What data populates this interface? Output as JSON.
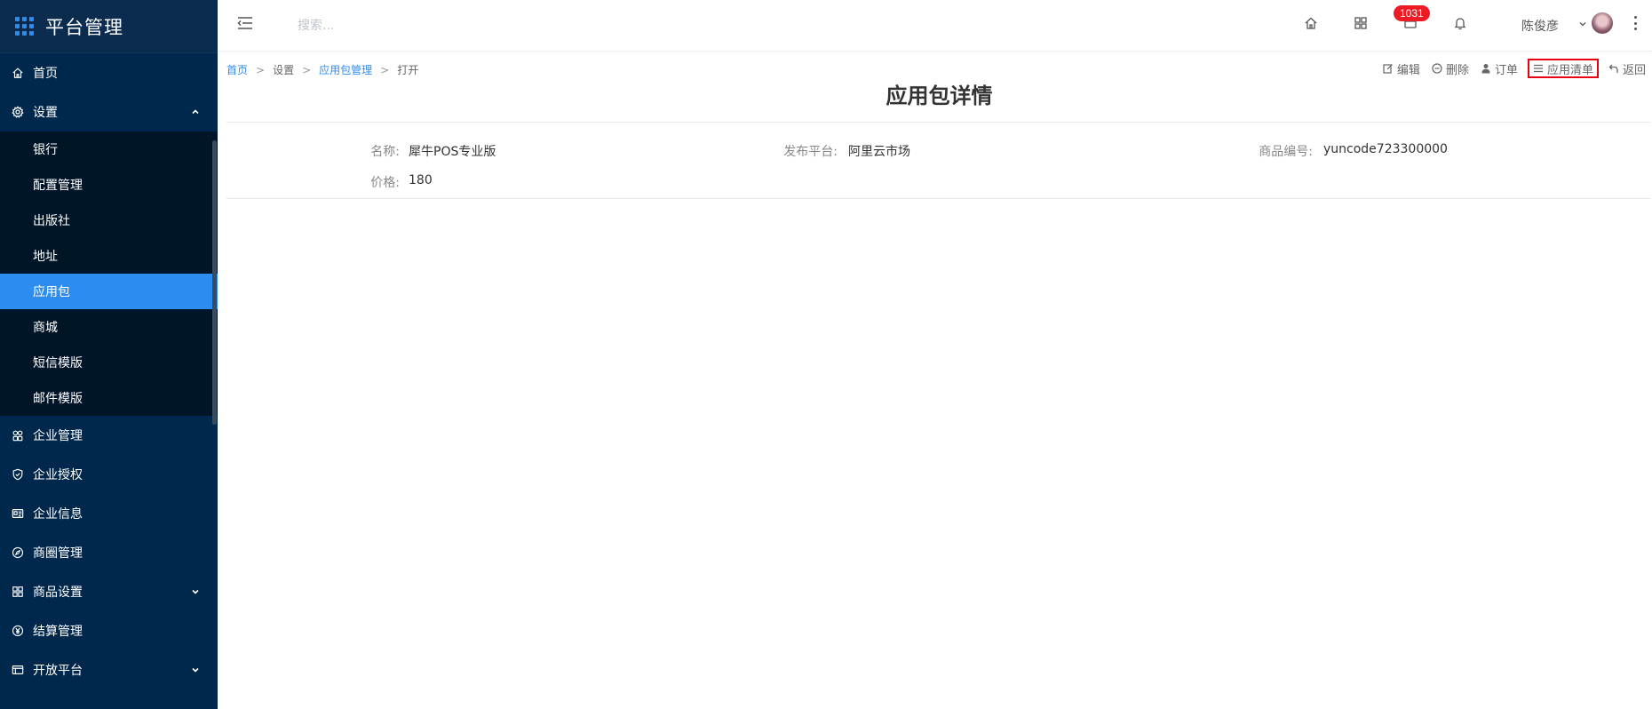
{
  "app": {
    "title": "平台管理"
  },
  "sidebar": {
    "items": [
      {
        "label": "首页",
        "icon": "home-icon"
      },
      {
        "label": "设置",
        "icon": "gear-icon",
        "expanded": true,
        "children": [
          {
            "label": "银行"
          },
          {
            "label": "配置管理"
          },
          {
            "label": "出版社"
          },
          {
            "label": "地址"
          },
          {
            "label": "应用包",
            "active": true
          },
          {
            "label": "商城"
          },
          {
            "label": "短信模版"
          },
          {
            "label": "邮件模版"
          }
        ]
      },
      {
        "label": "企业管理",
        "icon": "enterprise-icon"
      },
      {
        "label": "企业授权",
        "icon": "shield-icon"
      },
      {
        "label": "企业信息",
        "icon": "id-card-icon"
      },
      {
        "label": "商圈管理",
        "icon": "compass-icon"
      },
      {
        "label": "商品设置",
        "icon": "grid-icon",
        "collapsed": true
      },
      {
        "label": "结算管理",
        "icon": "yen-icon"
      },
      {
        "label": "开放平台",
        "icon": "panel-icon",
        "collapsed": true
      }
    ]
  },
  "header": {
    "search_placeholder": "搜索...",
    "badge_count": "1031",
    "user_name": "陈俊彦"
  },
  "breadcrumb": {
    "home": "首页",
    "settings": "设置",
    "package_mgmt": "应用包管理",
    "current": "打开",
    "separator": ">"
  },
  "actions": {
    "edit": "编辑",
    "delete": "删除",
    "order": "订单",
    "app_list": "应用清单",
    "back": "返回"
  },
  "page": {
    "title": "应用包详情",
    "fields": {
      "name_label": "名称:",
      "name_value": "犀牛POS专业版",
      "platform_label": "发布平台:",
      "platform_value": "阿里云市场",
      "code_label": "商品编号:",
      "code_value": "yuncode723300000",
      "price_label": "价格:",
      "price_value": "180"
    }
  },
  "colors": {
    "sidebar_bg": "#00284c",
    "submenu_bg": "#001528",
    "accent": "#2d8cf0",
    "badge": "#ed1c24",
    "highlight_border": "#e60012"
  }
}
